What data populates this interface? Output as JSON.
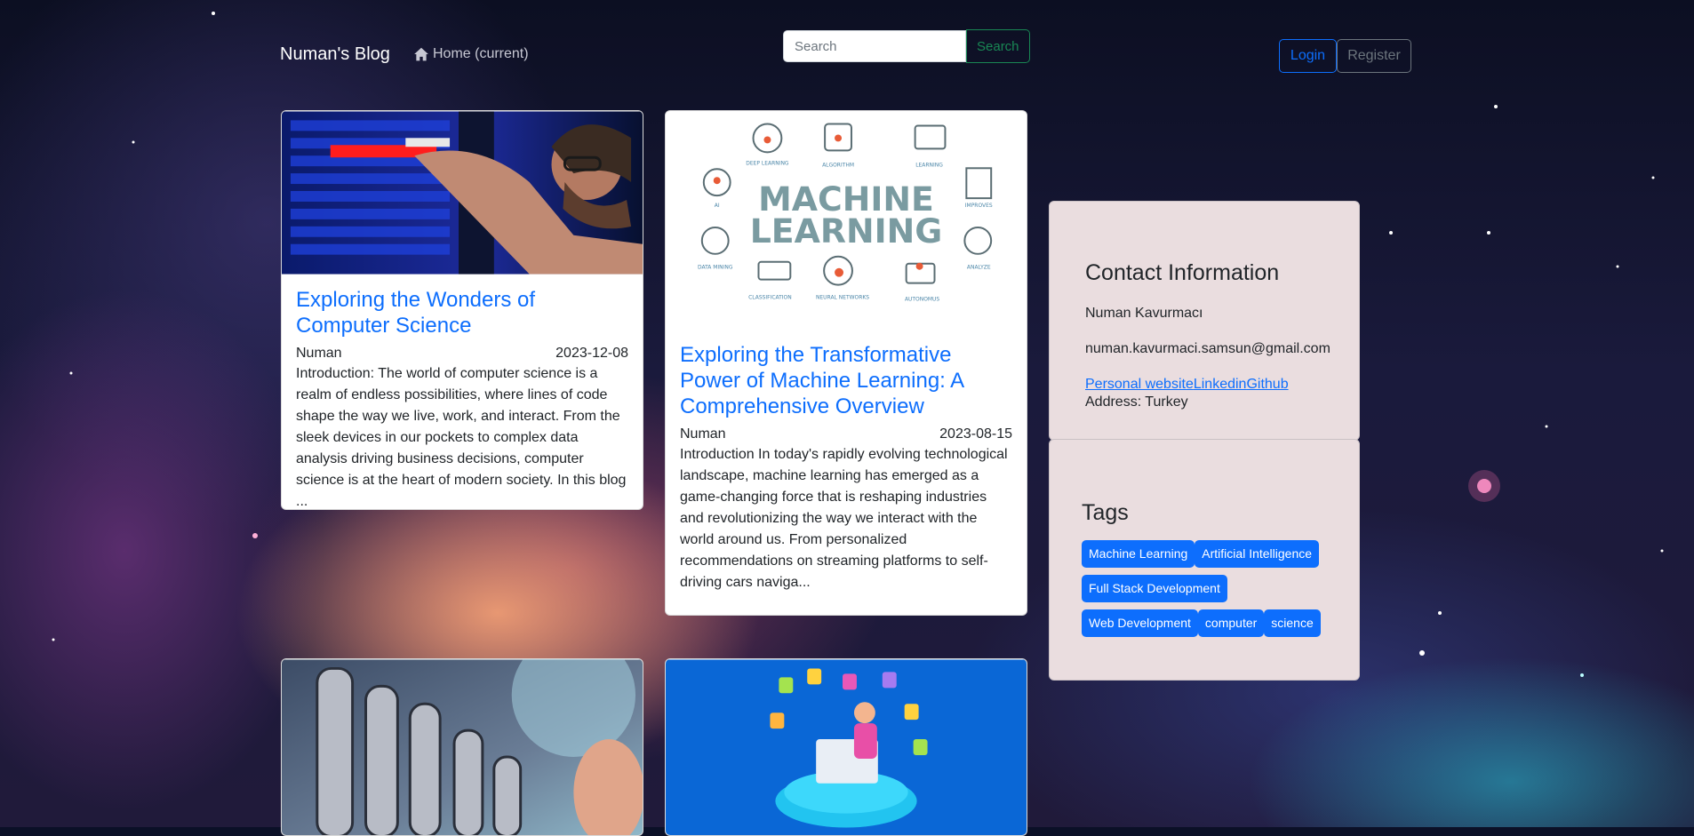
{
  "nav": {
    "brand": "Numan's Blog",
    "home_label": "Home (current)",
    "search_placeholder": "Search",
    "search_button": "Search",
    "login": "Login",
    "register": "Register"
  },
  "posts": [
    {
      "title": "Exploring the Wonders of Computer Science",
      "author": "Numan",
      "date": "2023-12-08",
      "excerpt": "Introduction: The world of computer science is a realm of endless possibilities, where lines of code shape the way we live, work, and interact. From the sleek devices in our pockets to complex data analysis driving business decisions, computer science is at the heart of modern society. In this blog ..."
    },
    {
      "title": "Exploring the Transformative Power of Machine Learning: A Comprehensive Overview",
      "author": "Numan",
      "date": "2023-08-15",
      "excerpt": "Introduction In today's rapidly evolving technological landscape, machine learning has emerged as a game-changing force that is reshaping industries and revolutionizing the way we interact with the world around us. From personalized recommendations on streaming platforms to self-driving cars naviga..."
    }
  ],
  "ml_image": {
    "title_line1": "MACHINE",
    "title_line2": "LEARNING",
    "labels": [
      "DEEP LEARNING",
      "ALGORITHM",
      "LEARNING",
      "AI",
      "IMPROVES",
      "DATA MINING",
      "CLASSIFICATION",
      "NEURAL NETWORKS",
      "AUTONOMUS",
      "ANALYZE"
    ]
  },
  "contact": {
    "heading": "Contact Information",
    "name": "Numan Kavurmacı",
    "email": "numan.kavurmaci.samsun@gmail.com",
    "link_personal": "Personal website",
    "link_linkedin": "Linkedin",
    "link_github": "Github",
    "address": "Address: Turkey"
  },
  "tags": {
    "heading": "Tags",
    "items": [
      "Machine Learning",
      "Artificial Intelligence",
      "Full Stack Development",
      "Web Development",
      "computer",
      "science"
    ]
  },
  "colors": {
    "primary": "#0d6efd",
    "success": "#198754",
    "secondary": "#6c757d",
    "sidebar_bg": "#eadddf"
  }
}
